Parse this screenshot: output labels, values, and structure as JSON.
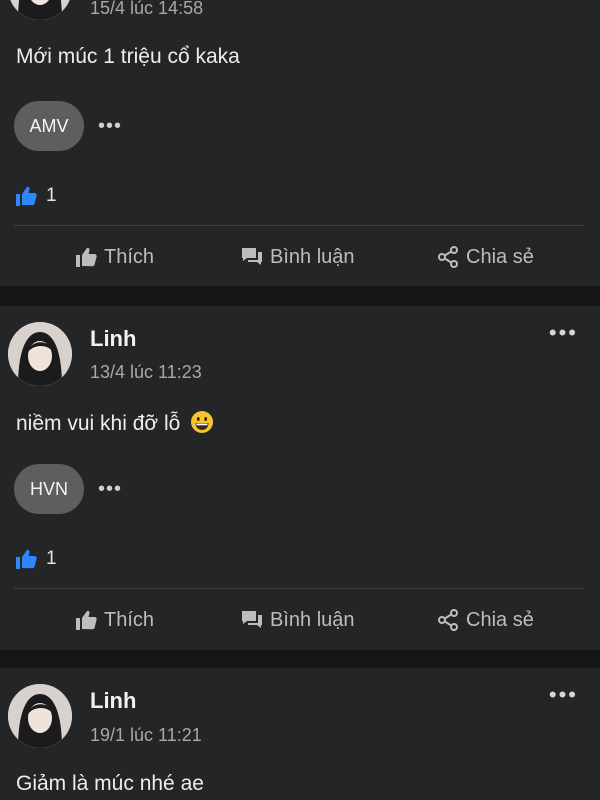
{
  "posts": [
    {
      "time": "15/4 lúc 14:58",
      "content": "Mới múc 1 triệu cổ kaka",
      "tag": "AMV",
      "tag_more": "•••",
      "reaction_count": "1",
      "actions": {
        "like": "Thích",
        "comment": "Bình luận",
        "share": "Chia sẻ"
      }
    },
    {
      "author": "Linh",
      "time": "13/4 lúc 11:23",
      "content": "niềm vui khi đỡ lỗ",
      "emoji": "grinning-face",
      "tag": "HVN",
      "tag_more": "•••",
      "reaction_count": "1",
      "menu": "•••",
      "actions": {
        "like": "Thích",
        "comment": "Bình luận",
        "share": "Chia sẻ"
      }
    },
    {
      "author": "Linh",
      "time": "19/1 lúc 11:21",
      "content": "Giảm là múc nhé ae",
      "menu": "•••"
    }
  ],
  "colors": {
    "background": "#161616",
    "card": "#242526",
    "like_blue": "#2d88ff",
    "tag_bg": "#5d5e60"
  }
}
